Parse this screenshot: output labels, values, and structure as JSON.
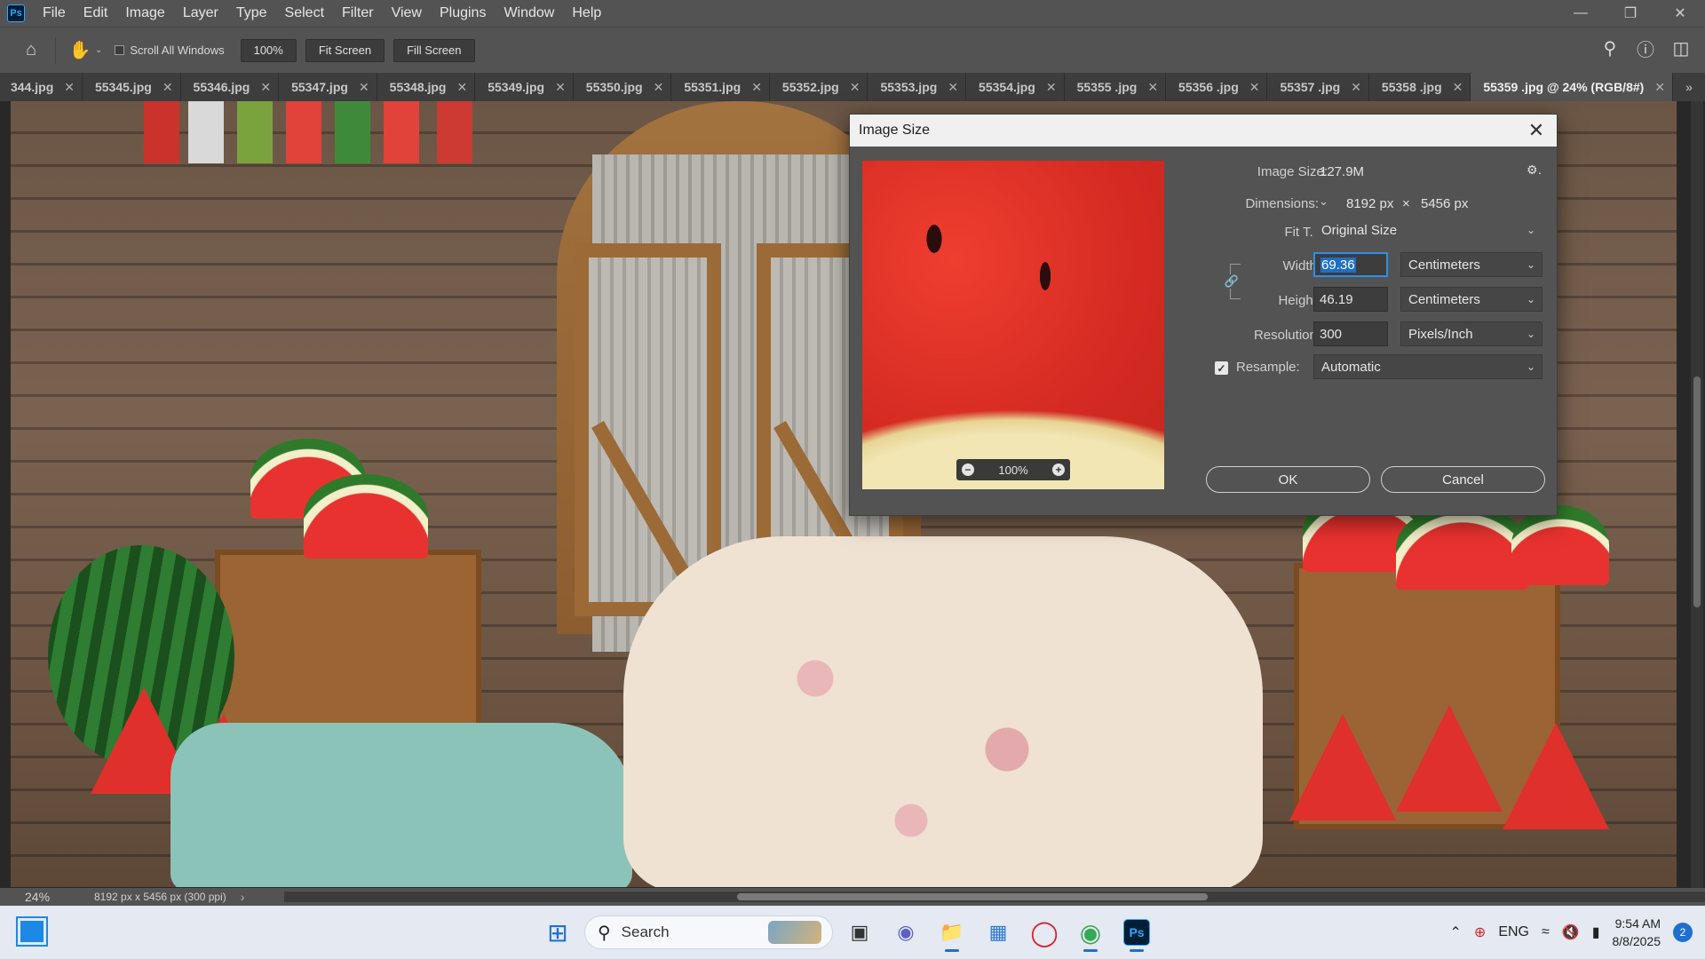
{
  "app": {
    "logo": "Ps",
    "menu": [
      "File",
      "Edit",
      "Image",
      "Layer",
      "Type",
      "Select",
      "Filter",
      "View",
      "Plugins",
      "Window",
      "Help"
    ],
    "window_controls": [
      "minimize-icon",
      "restore-icon",
      "close-icon"
    ]
  },
  "options": {
    "scroll_all_windows": "Scroll All Windows",
    "scroll_all_checked": false,
    "zoom_btn": "100%",
    "fit_screen": "Fit Screen",
    "fill_screen": "Fill Screen"
  },
  "tabs": [
    {
      "label": "344.jpg",
      "active": false
    },
    {
      "label": "55345.jpg",
      "active": false
    },
    {
      "label": "55346.jpg",
      "active": false
    },
    {
      "label": "55347.jpg",
      "active": false
    },
    {
      "label": "55348.jpg",
      "active": false
    },
    {
      "label": "55349.jpg",
      "active": false
    },
    {
      "label": "55350.jpg",
      "active": false
    },
    {
      "label": "55351.jpg",
      "active": false
    },
    {
      "label": "55352.jpg",
      "active": false
    },
    {
      "label": "55353.jpg",
      "active": false
    },
    {
      "label": "55354.jpg",
      "active": false
    },
    {
      "label": "55355 .jpg",
      "active": false
    },
    {
      "label": "55356 .jpg",
      "active": false
    },
    {
      "label": "55357 .jpg",
      "active": false
    },
    {
      "label": "55358 .jpg",
      "active": false
    },
    {
      "label": "55359 .jpg @ 24% (RGB/8#)",
      "active": true
    }
  ],
  "status": {
    "zoom": "24%",
    "doc_info": "8192 px x 5456 px (300 ppi)",
    "arrow": "›"
  },
  "dialog": {
    "title": "Image Size",
    "preview_zoom": "100%",
    "image_size_label": "Image Size:",
    "image_size_value": "127.9M",
    "dimensions_label": "Dimensions:",
    "dim_width": "8192 px",
    "dim_times": "×",
    "dim_height": "5456 px",
    "fit_label": "Fit T...",
    "fit_value": "Original Size",
    "width_label": "Width:",
    "width_value": "69.36",
    "width_unit": "Centimeters",
    "height_label": "Height:",
    "height_value": "46.19",
    "height_unit": "Centimeters",
    "resolution_label": "Resolution:",
    "resolution_value": "300",
    "resolution_unit": "Pixels/Inch",
    "resample_label": "Resample:",
    "resample_checked": true,
    "resample_value": "Automatic",
    "ok": "OK",
    "cancel": "Cancel"
  },
  "taskbar": {
    "search": "Search",
    "lang": "ENG",
    "time": "9:54 AM",
    "date": "8/8/2025",
    "notifications": "2"
  }
}
